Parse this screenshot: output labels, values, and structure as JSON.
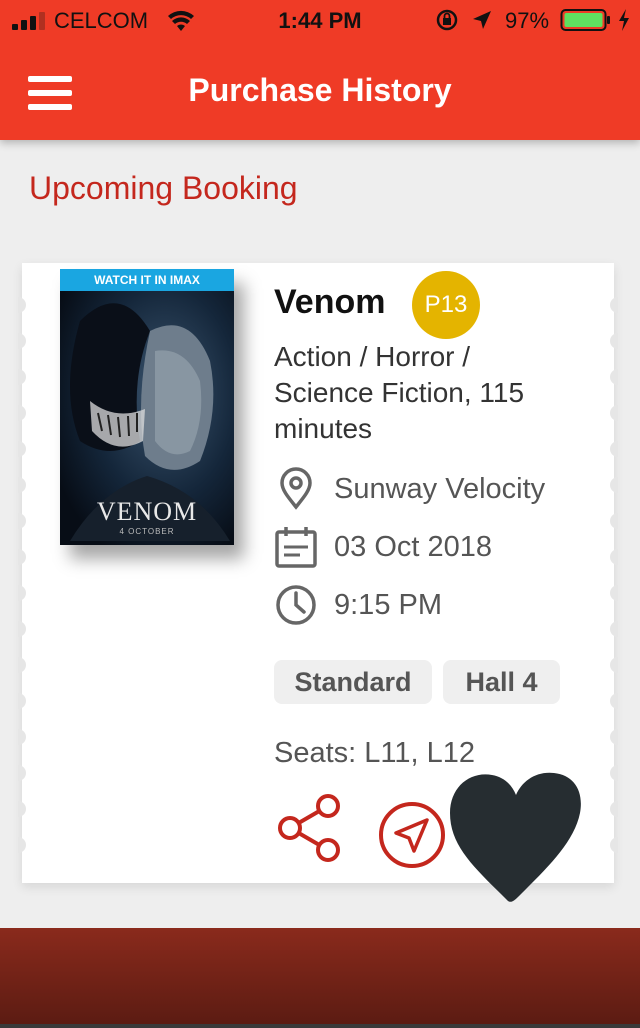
{
  "status_bar": {
    "carrier": "CELCOM",
    "time": "1:44 PM",
    "battery_percent": "97%",
    "icons": [
      "signal-icon",
      "wifi-icon",
      "rotation-lock-icon",
      "location-icon",
      "battery-icon",
      "charging-icon"
    ]
  },
  "app_bar": {
    "title": "Purchase History",
    "menu_icon": "menu-icon"
  },
  "section": {
    "title": "Upcoming Booking"
  },
  "booking": {
    "poster": {
      "band_text": "WATCH IT IN IMAX",
      "title": "VENOM",
      "date": "4 OCTOBER"
    },
    "movie_title": "Venom",
    "rating": "P13",
    "genre": "Action / Horror / Science Fiction, 115 minutes",
    "cinema": "Sunway Velocity",
    "date": "03 Oct 2018",
    "time": "9:15 PM",
    "format": "Standard",
    "hall": "Hall 4",
    "seats": "Seats: L11, L12",
    "actions": [
      "share-icon",
      "navigation-icon"
    ]
  },
  "colors": {
    "app_bar": "#ef3b26",
    "accent": "#c4271d",
    "rating_badge": "#e4b400",
    "background": "#eeeeee"
  }
}
